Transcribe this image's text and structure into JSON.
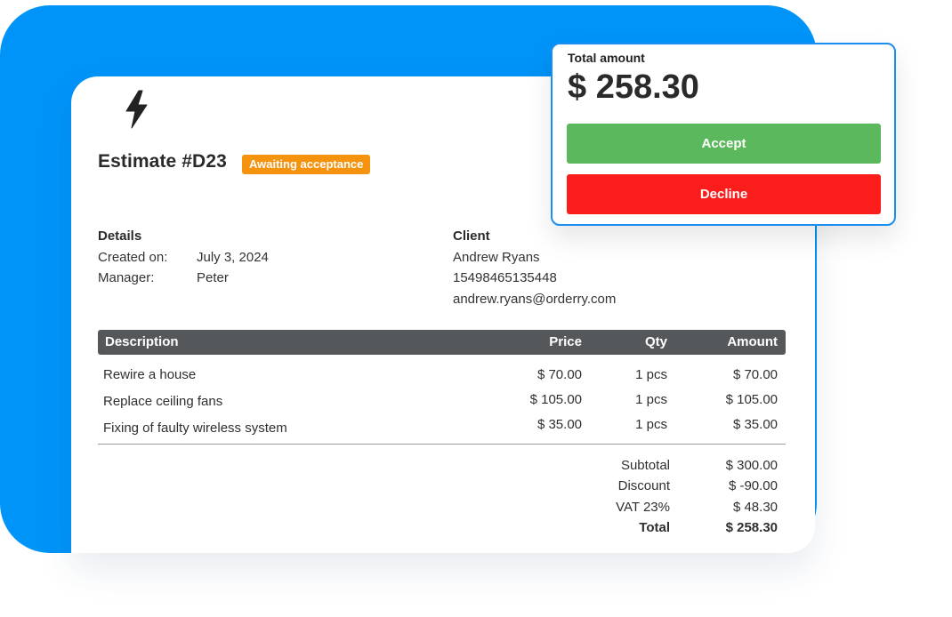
{
  "estimate": {
    "title": "Estimate #D23",
    "status_badge": "Awaiting acceptance"
  },
  "details": {
    "heading": "Details",
    "created_label": "Created on:",
    "created_value": "July 3, 2024",
    "manager_label": "Manager:",
    "manager_value": "Peter"
  },
  "client": {
    "heading": "Client",
    "name": "Andrew Ryans",
    "phone": "15498465135448",
    "email": "andrew.ryans@orderry.com"
  },
  "table": {
    "headers": {
      "description": "Description",
      "price": "Price",
      "qty": "Qty",
      "amount": "Amount"
    },
    "rows": [
      {
        "description": "Rewire a house",
        "price": "$ 70.00",
        "qty": "1 pcs",
        "amount": "$ 70.00"
      },
      {
        "description": "Replace ceiling fans",
        "price": "$ 105.00",
        "qty": "1 pcs",
        "amount": "$ 105.00"
      },
      {
        "description": "Fixing of faulty wireless system",
        "price": "$ 35.00",
        "qty": "1 pcs",
        "amount": "$ 35.00"
      }
    ]
  },
  "totals": {
    "subtotal_label": "Subtotal",
    "subtotal_value": "$ 300.00",
    "discount_label": "Discount",
    "discount_value": "$ -90.00",
    "vat_label": "VAT 23%",
    "vat_value": "$ 48.30",
    "total_label": "Total",
    "total_value": "$ 258.30"
  },
  "popup": {
    "label": "Total amount",
    "amount": "$ 258.30",
    "accept_label": "Accept",
    "decline_label": "Decline"
  },
  "colors": {
    "background_accent": "#0094f8",
    "badge": "#f5930f",
    "accept": "#5cb85c",
    "decline": "#fb1c1c",
    "table_header": "#55585b",
    "popup_border": "#1b8ff0"
  },
  "icons": {
    "logo": "lightning-bolt-icon"
  }
}
